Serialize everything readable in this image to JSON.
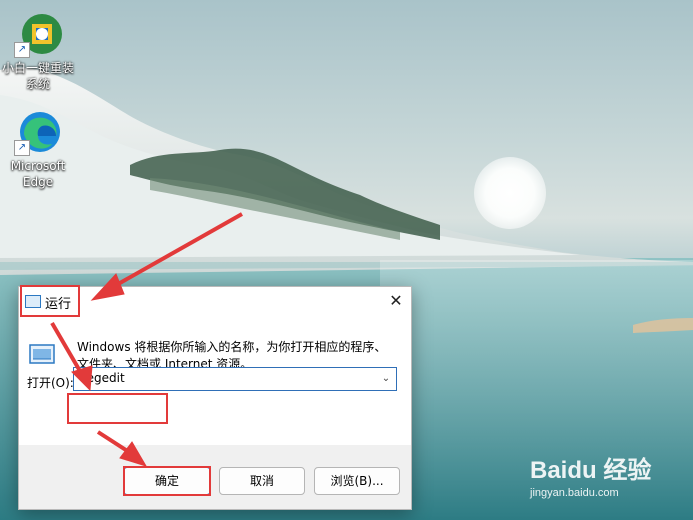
{
  "desktop": {
    "icons": [
      {
        "label": "小白一键重装系统",
        "icon": "xiaobai-reinstall-icon"
      },
      {
        "label": "Microsoft Edge",
        "icon": "edge-icon"
      }
    ]
  },
  "dialog": {
    "title": "运行",
    "close_label": "✕",
    "description": "Windows 将根据你所输入的名称，为你打开相应的程序、文件夹、文档或 Internet 资源。",
    "open_label": "打开(O):",
    "open_value": "regedit",
    "buttons": {
      "ok": "确定",
      "cancel": "取消",
      "browse": "浏览(B)..."
    }
  },
  "watermark": {
    "logo": "Baidu 经验",
    "url": "jingyan.baidu.com"
  },
  "colors": {
    "highlight": "#e23a3a",
    "accent": "#0a64c2"
  }
}
